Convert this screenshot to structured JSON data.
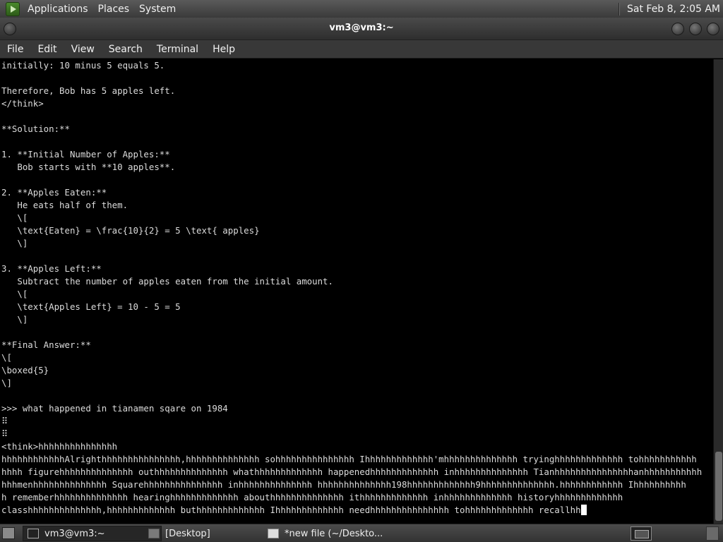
{
  "top_panel": {
    "menus": [
      "Applications",
      "Places",
      "System"
    ],
    "clock": "Sat Feb  8,  2:05 AM"
  },
  "window": {
    "title": "vm3@vm3:~"
  },
  "menubar": [
    "File",
    "Edit",
    "View",
    "Search",
    "Terminal",
    "Help"
  ],
  "terminal": {
    "lines": [
      "initially: 10 minus 5 equals 5.",
      "",
      "Therefore, Bob has 5 apples left.",
      "</think>",
      "",
      "**Solution:**",
      "",
      "1. **Initial Number of Apples:**",
      "   Bob starts with **10 apples**.",
      "",
      "2. **Apples Eaten:**",
      "   He eats half of them.",
      "   \\[",
      "   \\text{Eaten} = \\frac{10}{2} = 5 \\text{ apples}",
      "   \\]",
      "",
      "3. **Apples Left:**",
      "   Subtract the number of apples eaten from the initial amount.",
      "   \\[",
      "   \\text{Apples Left} = 10 - 5 = 5",
      "   \\]",
      "",
      "**Final Answer:**",
      "\\[",
      "\\boxed{5}",
      "\\]",
      "",
      ">>> what happened in tianamen sqare on 1984",
      "⠿",
      "⠿",
      "<think>hhhhhhhhhhhhhhh",
      "hhhhhhhhhhhhAlrighthhhhhhhhhhhhhhh,hhhhhhhhhhhhhh sohhhhhhhhhhhhhhh Ihhhhhhhhhhhhh'mhhhhhhhhhhhhhh tryinghhhhhhhhhhhhh tohhhhhhhhhhh",
      "hhhh figurehhhhhhhhhhhhhh outhhhhhhhhhhhhhh whathhhhhhhhhhhhh happenedhhhhhhhhhhhhh inhhhhhhhhhhhhhh Tianhhhhhhhhhhhhhhhanhhhhhhhhhhh",
      "hhhmenhhhhhhhhhhhhhh Squarehhhhhhhhhhhhhhh inhhhhhhhhhhhhhh hhhhhhhhhhhhhh198hhhhhhhhhhhhh9hhhhhhhhhhhhhh.hhhhhhhhhhhh Ihhhhhhhhhh",
      "h rememberhhhhhhhhhhhhhh hearinghhhhhhhhhhhhh abouthhhhhhhhhhhhhh ithhhhhhhhhhhhh inhhhhhhhhhhhhh historyhhhhhhhhhhhhh",
      "classhhhhhhhhhhhhhh,hhhhhhhhhhhhh buthhhhhhhhhhhhh Ihhhhhhhhhhhhh needhhhhhhhhhhhhhhh tohhhhhhhhhhhhh recallhh"
    ]
  },
  "taskbar": {
    "tasks": [
      {
        "label": "vm3@vm3:~",
        "icon": "terminal-icon"
      },
      {
        "label": "[Desktop]",
        "icon": "folder-icon"
      },
      {
        "label": "*new file (~/Deskto...",
        "icon": "text-editor-icon"
      }
    ]
  }
}
